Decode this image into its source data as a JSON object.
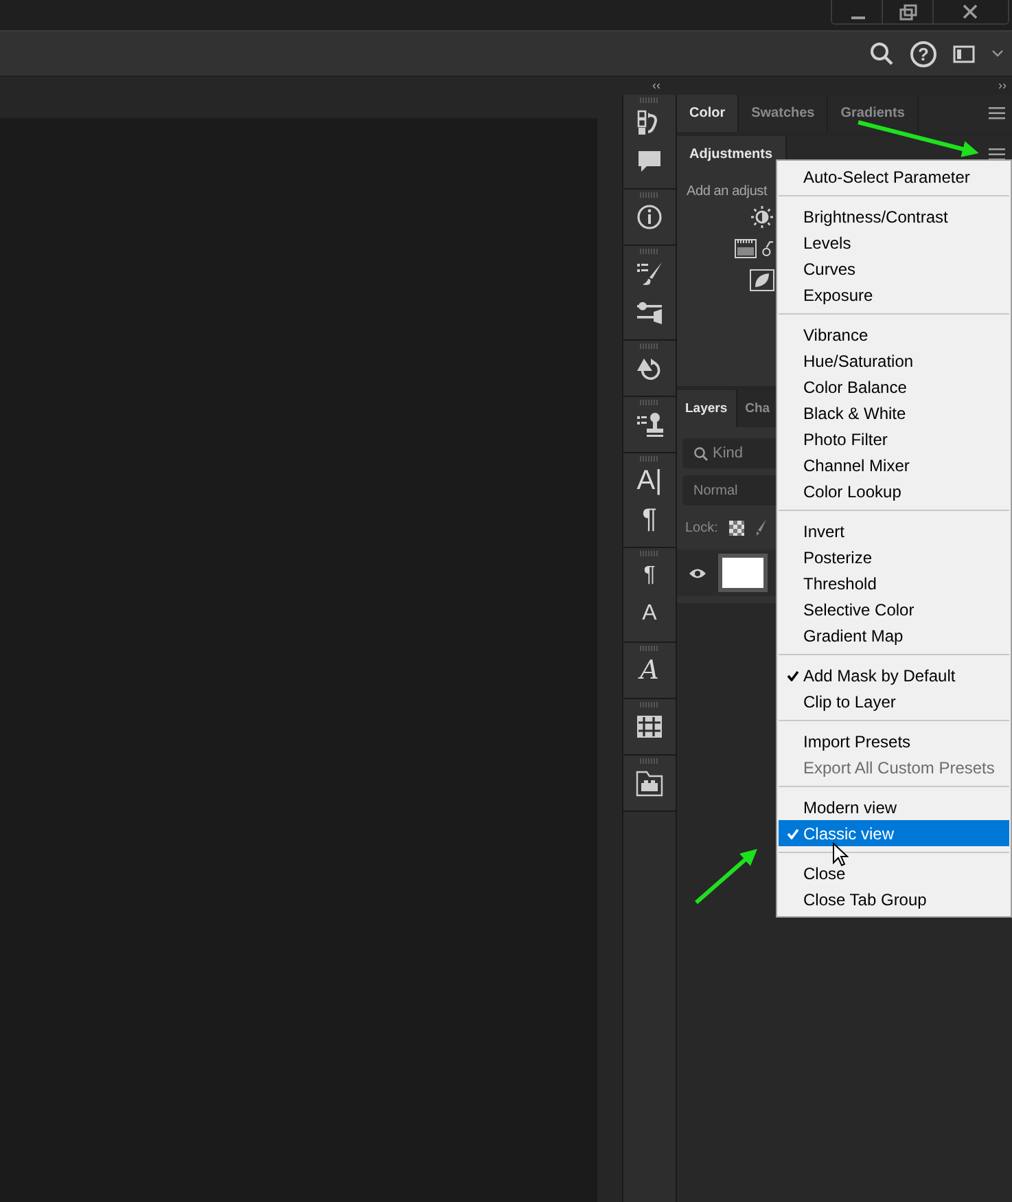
{
  "title_bar": {
    "controls": [
      {
        "kind": "minimize"
      },
      {
        "kind": "restore"
      },
      {
        "kind": "close"
      }
    ]
  },
  "options_bar": {
    "help_glyph": "?"
  },
  "dock_header": {
    "collapse_left": "‹‹",
    "collapse_right": "››"
  },
  "tool_column": [
    {
      "icons": [
        {
          "kind": "history"
        },
        {
          "kind": "comment"
        }
      ]
    },
    {
      "icons": [
        {
          "kind": "info"
        }
      ]
    },
    {
      "icons": [
        {
          "kind": "brush-presets"
        },
        {
          "kind": "brush-settings"
        }
      ]
    },
    {
      "icons": [
        {
          "kind": "history-brush"
        }
      ]
    },
    {
      "icons": [
        {
          "kind": "clone-source"
        }
      ]
    },
    {
      "icons": [
        {
          "kind": "glyph",
          "glyph": "A|"
        },
        {
          "kind": "glyph",
          "glyph": "¶"
        }
      ]
    },
    {
      "icons": [
        {
          "kind": "glyph-small",
          "glyph": "¶"
        },
        {
          "kind": "glyph-small",
          "glyph": "A"
        }
      ]
    },
    {
      "icons": [
        {
          "kind": "script",
          "glyph": "A"
        }
      ]
    },
    {
      "icons": [
        {
          "kind": "grid"
        }
      ]
    },
    {
      "icons": [
        {
          "kind": "folder"
        }
      ]
    }
  ],
  "color_panel": {
    "tabs": [
      {
        "label": "Color",
        "selected": true
      },
      {
        "label": "Swatches",
        "selected": false
      },
      {
        "label": "Gradients",
        "selected": false
      }
    ]
  },
  "adjustments_panel": {
    "tabs": [
      {
        "label": "Adjustments",
        "selected": true
      }
    ],
    "hint": "Add an adjust"
  },
  "layers_panel": {
    "tabs": [
      {
        "label": "Layers",
        "selected": true
      },
      {
        "label": "Cha",
        "selected": false
      }
    ],
    "filter": {
      "placeholder": "Kind"
    },
    "blend_mode": "Normal",
    "lock_label": "Lock:"
  },
  "menu": {
    "sections": [
      [
        {
          "label": "Auto-Select Parameter",
          "checked": false,
          "disabled": false,
          "selected": false
        }
      ],
      [
        {
          "label": "Brightness/Contrast",
          "checked": false,
          "disabled": false,
          "selected": false
        },
        {
          "label": "Levels",
          "checked": false,
          "disabled": false,
          "selected": false
        },
        {
          "label": "Curves",
          "checked": false,
          "disabled": false,
          "selected": false
        },
        {
          "label": "Exposure",
          "checked": false,
          "disabled": false,
          "selected": false
        }
      ],
      [
        {
          "label": "Vibrance",
          "checked": false,
          "disabled": false,
          "selected": false
        },
        {
          "label": "Hue/Saturation",
          "checked": false,
          "disabled": false,
          "selected": false
        },
        {
          "label": "Color Balance",
          "checked": false,
          "disabled": false,
          "selected": false
        },
        {
          "label": "Black & White",
          "checked": false,
          "disabled": false,
          "selected": false
        },
        {
          "label": "Photo Filter",
          "checked": false,
          "disabled": false,
          "selected": false
        },
        {
          "label": "Channel Mixer",
          "checked": false,
          "disabled": false,
          "selected": false
        },
        {
          "label": "Color Lookup",
          "checked": false,
          "disabled": false,
          "selected": false
        }
      ],
      [
        {
          "label": "Invert",
          "checked": false,
          "disabled": false,
          "selected": false
        },
        {
          "label": "Posterize",
          "checked": false,
          "disabled": false,
          "selected": false
        },
        {
          "label": "Threshold",
          "checked": false,
          "disabled": false,
          "selected": false
        },
        {
          "label": "Selective Color",
          "checked": false,
          "disabled": false,
          "selected": false
        },
        {
          "label": "Gradient Map",
          "checked": false,
          "disabled": false,
          "selected": false
        }
      ],
      [
        {
          "label": "Add Mask by Default",
          "checked": true,
          "disabled": false,
          "selected": false
        },
        {
          "label": "Clip to Layer",
          "checked": false,
          "disabled": false,
          "selected": false
        }
      ],
      [
        {
          "label": "Import Presets",
          "checked": false,
          "disabled": false,
          "selected": false
        },
        {
          "label": "Export All Custom Presets",
          "checked": false,
          "disabled": true,
          "selected": false
        }
      ],
      [
        {
          "label": "Modern view",
          "checked": false,
          "disabled": false,
          "selected": false
        },
        {
          "label": "Classic view",
          "checked": true,
          "disabled": false,
          "selected": true
        }
      ],
      [
        {
          "label": "Close",
          "checked": false,
          "disabled": false,
          "selected": false
        },
        {
          "label": "Close Tab Group",
          "checked": false,
          "disabled": false,
          "selected": false
        }
      ]
    ]
  }
}
